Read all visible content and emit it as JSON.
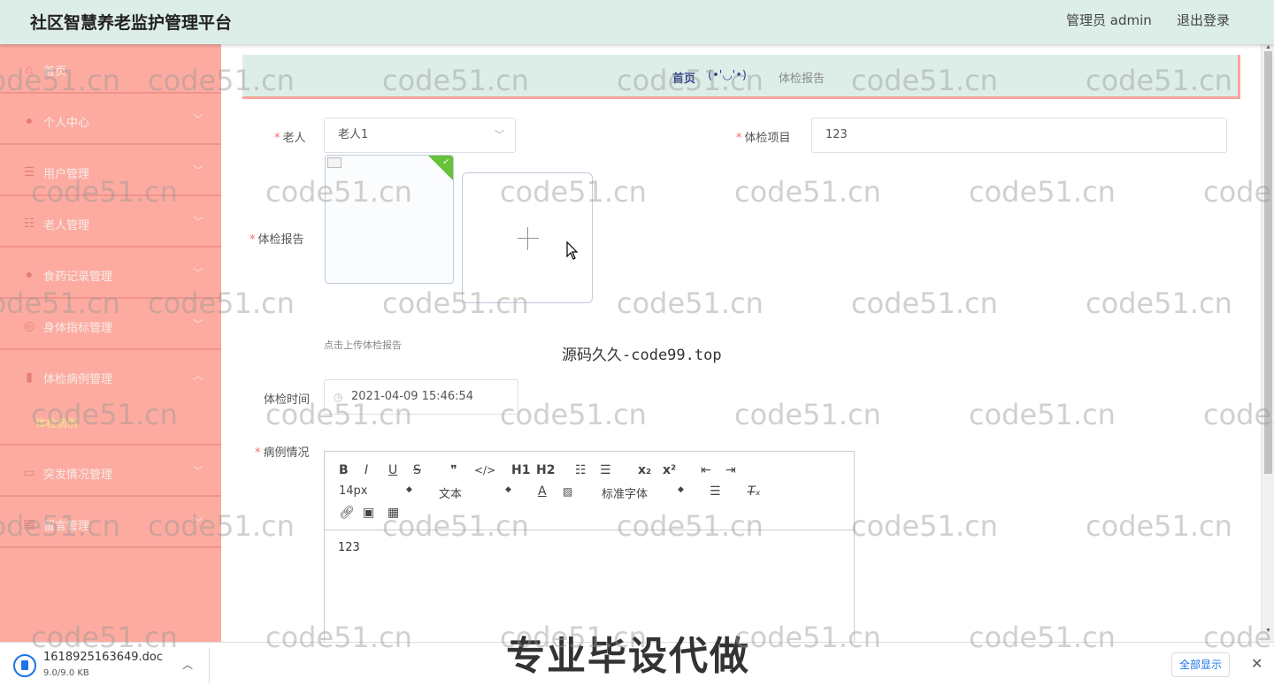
{
  "header": {
    "title": "社区智慧养老监护管理平台",
    "user": "管理员 admin",
    "logout": "退出登录"
  },
  "sidebar": {
    "items": [
      {
        "label": "首页",
        "icon": "home-icon",
        "glyph": "⌂",
        "arrow": ""
      },
      {
        "label": "个人中心",
        "icon": "user-icon",
        "glyph": "●",
        "arrow": "﹀"
      },
      {
        "label": "用户管理",
        "icon": "sliders-icon",
        "glyph": "☰",
        "arrow": "﹀"
      },
      {
        "label": "老人管理",
        "icon": "list-icon",
        "glyph": "☷",
        "arrow": "﹀"
      },
      {
        "label": "食药记录管理",
        "icon": "user-icon",
        "glyph": "●",
        "arrow": "﹀"
      },
      {
        "label": "身体指标管理",
        "icon": "lifebuoy-icon",
        "glyph": "◎",
        "arrow": "﹀"
      },
      {
        "label": "体检病例管理",
        "icon": "flag-icon",
        "glyph": "▮",
        "arrow": "︿"
      },
      {
        "label": "突发情况管理",
        "icon": "briefcase-icon",
        "glyph": "▭",
        "arrow": "﹀"
      },
      {
        "label": "留言管理",
        "icon": "clipboard-icon",
        "glyph": "▤",
        "arrow": "﹀"
      }
    ],
    "submenu": "体检病例"
  },
  "breadcrumb": {
    "home": "首页",
    "separator": "(•'◡'•)",
    "current": "体检报告"
  },
  "form": {
    "elder_label": "老人",
    "elder_value": "老人1",
    "item_label": "体检项目",
    "item_value": "123",
    "report_label": "体检报告",
    "upload_tip": "点击上传体检报告",
    "time_label": "体检时间",
    "time_value": "2021-04-09 15:46:54",
    "case_label": "病例情况",
    "required_mark": "*"
  },
  "editor": {
    "buttons_row1": [
      "B",
      "I",
      "U",
      "S",
      "❞",
      "</>",
      "H1",
      "H2",
      "☷",
      "☰",
      "x₂",
      "x²",
      "⇤",
      "⇥"
    ],
    "size_value": "14px",
    "format_value": "文本",
    "font_value": "标准字体",
    "content": "123"
  },
  "promo_text": "源码久久-code99.top",
  "download": {
    "filename": "1618925163649.doc",
    "size": "9.0/9.0 KB",
    "show_all": "全部显示"
  },
  "banner": "专业毕设代做",
  "watermark": "code51.cn",
  "colors": {
    "sidebar": "#fdaba0",
    "topbar": "#ddeee8",
    "accent_blue": "#2d3e8c",
    "required": "#f56c6c"
  }
}
